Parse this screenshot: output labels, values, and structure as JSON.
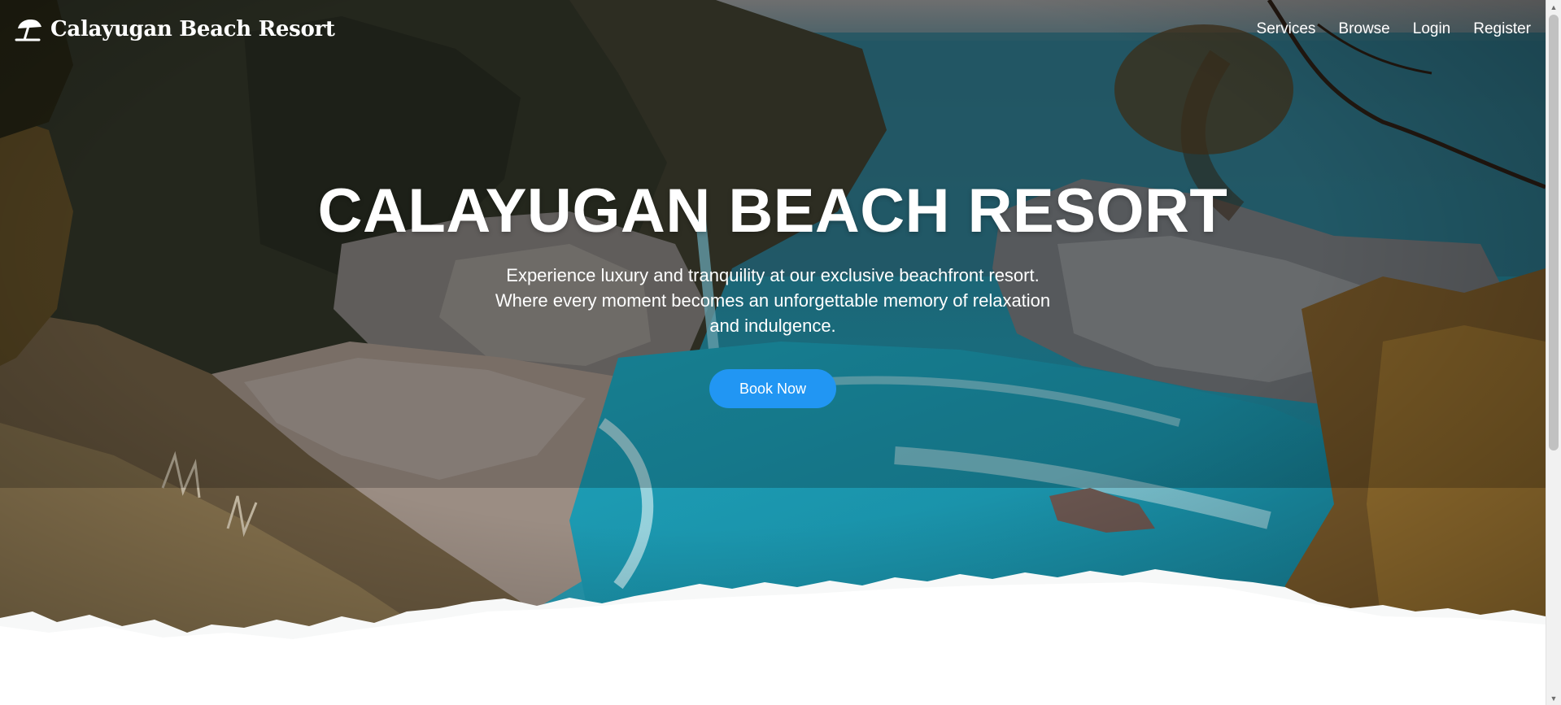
{
  "brand": {
    "name": "Calayugan Beach Resort",
    "icon": "beach-umbrella-icon"
  },
  "nav": {
    "items": [
      "Services",
      "Browse",
      "Login",
      "Register"
    ]
  },
  "hero": {
    "title": "CALAYUGAN BEACH RESORT",
    "subtitle_lines": [
      "Experience luxury and tranquility at our exclusive beachfront resort.",
      "Where every moment becomes an unforgettable memory of relaxation",
      "and indulgence."
    ],
    "cta_label": "Book Now"
  },
  "colors": {
    "accent": "#2196f3",
    "text": "#ffffff",
    "page_bg": "#ffffff"
  },
  "scrollbar": {
    "up_icon": "scroll-up-arrow-icon",
    "down_icon": "scroll-down-arrow-icon"
  }
}
